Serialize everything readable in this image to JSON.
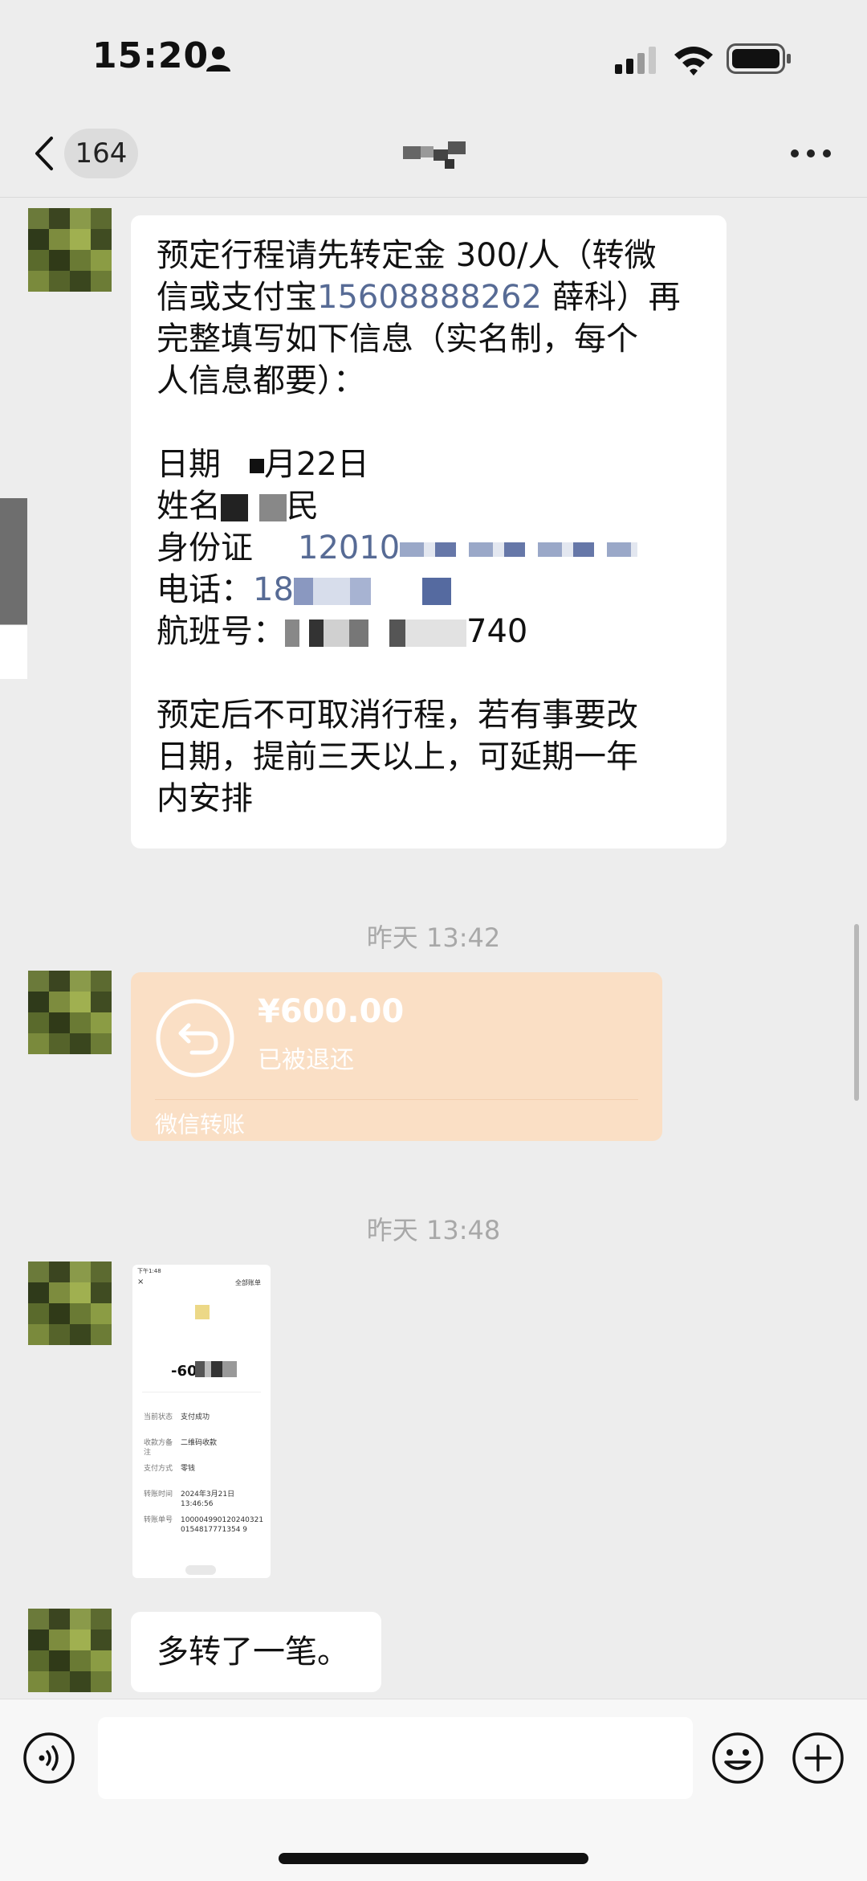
{
  "status_bar": {
    "time": "15:20"
  },
  "nav": {
    "unread_count": "164"
  },
  "messages": {
    "m1": {
      "line1": "预定行程请先转定金 300/人（转微",
      "line2_pre": "信或支付宝",
      "phone": "15608888262",
      "line2_post": " 薛科）再",
      "line3": "完整填写如下信息（实名制，每个",
      "line4": "人信息都要）：",
      "date_label": "日期",
      "date_value": "月22日",
      "name_label": "姓名",
      "name_value": "民",
      "id_label": "身份证",
      "id_value": "12010",
      "phone_label": "电话：",
      "phone_value": "18",
      "flight_label": "航班号：",
      "flight_value": "740",
      "footer1": "预定后不可取消行程，若有事要改",
      "footer2": "日期，提前三天以上，可延期一年",
      "footer3": "内安排"
    },
    "timestamp1": "昨天 13:42",
    "transfer": {
      "amount": "¥600.00",
      "status": "已被退还",
      "label": "微信转账"
    },
    "timestamp2": "昨天 13:48",
    "screenshot": {
      "time": "下午1:48",
      "all_bills": "全部账单",
      "amount": "-600.00",
      "rows": [
        {
          "label": "当前状态",
          "value": "支付成功"
        },
        {
          "label": "收款方备注",
          "value": "二维码收款"
        },
        {
          "label": "支付方式",
          "value": "零钱"
        },
        {
          "label": "转账时间",
          "value": "2024年3月21日 13:46:56"
        },
        {
          "label": "转账单号",
          "value": "1000049901202403210154817771354 9"
        }
      ]
    },
    "m4": "多转了一笔。"
  },
  "colors": {
    "background": "#ededed",
    "bubble": "#ffffff",
    "link": "#576b95",
    "transfer_card": "#fadfc5",
    "timestamp": "#a8a8a8"
  }
}
